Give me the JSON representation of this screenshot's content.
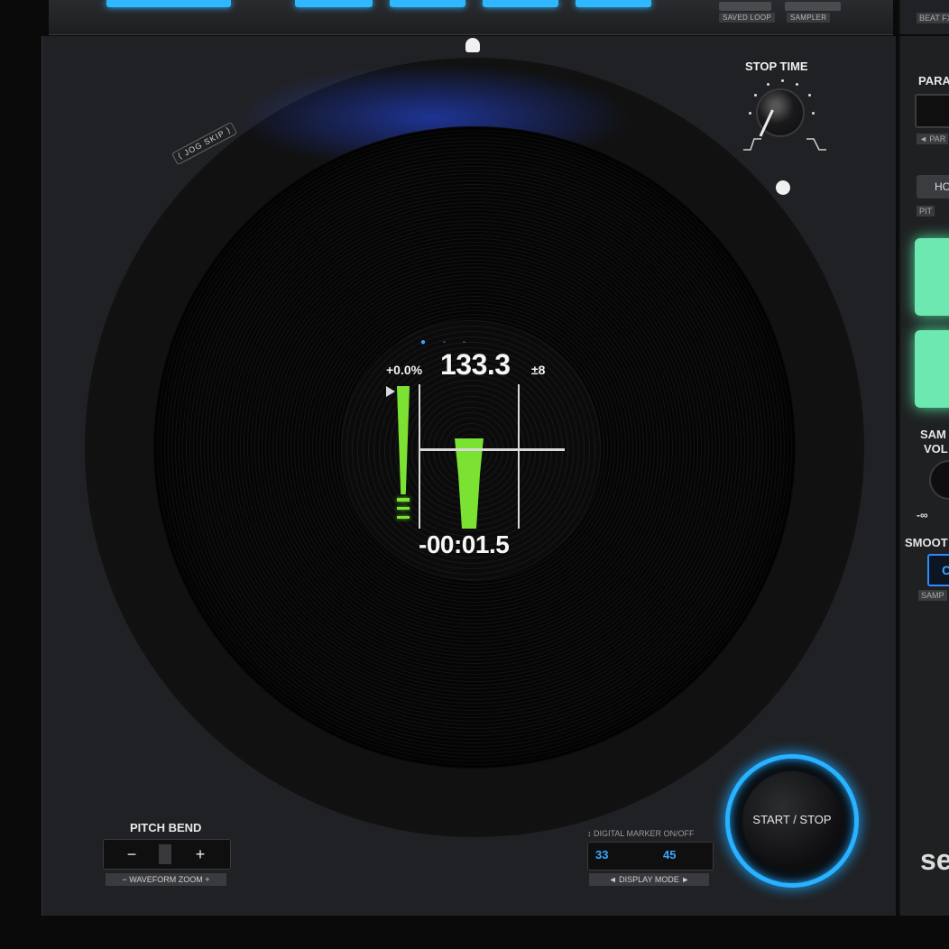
{
  "top_strip": {
    "saved_loop_label": "SAVED LOOP",
    "sampler_label": "SAMPLER",
    "beat_fx_label": "BEAT FX"
  },
  "stop_time": {
    "label": "STOP TIME"
  },
  "jog": {
    "skip_label": "⟨ JOG SKIP ⟩"
  },
  "display": {
    "indicator_dots": "● - -",
    "pitch": "+0.0%",
    "bpm": "133.3",
    "pitch_range": "±8",
    "time": "-00:01.5"
  },
  "pitch_bend": {
    "label": "PITCH BEND",
    "minus": "−",
    "plus": "+",
    "sub_label": "− WAVEFORM ZOOM +"
  },
  "display_mode": {
    "top_label": "↕ DIGITAL MARKER ON/OFF",
    "left_value": "33",
    "right_value": "45",
    "sub_label": "◄ DISPLAY MODE ►"
  },
  "start_stop": {
    "label": "START / STOP"
  },
  "right_panel": {
    "para_label": "PARA",
    "para_sub": "◄ PAR",
    "ho_label": "HO",
    "pit_label": "PIT",
    "sample_label": "SAM",
    "volume_label": "VOL",
    "minus_inf": "-∞",
    "smooth_label": "SMOOT",
    "c_label": "C",
    "samp_sub": "SAMP"
  },
  "brand": "se",
  "colors": {
    "accent_blue": "#28b2ff",
    "waveform_green": "#7be233",
    "pad_green": "#6de8b0"
  }
}
